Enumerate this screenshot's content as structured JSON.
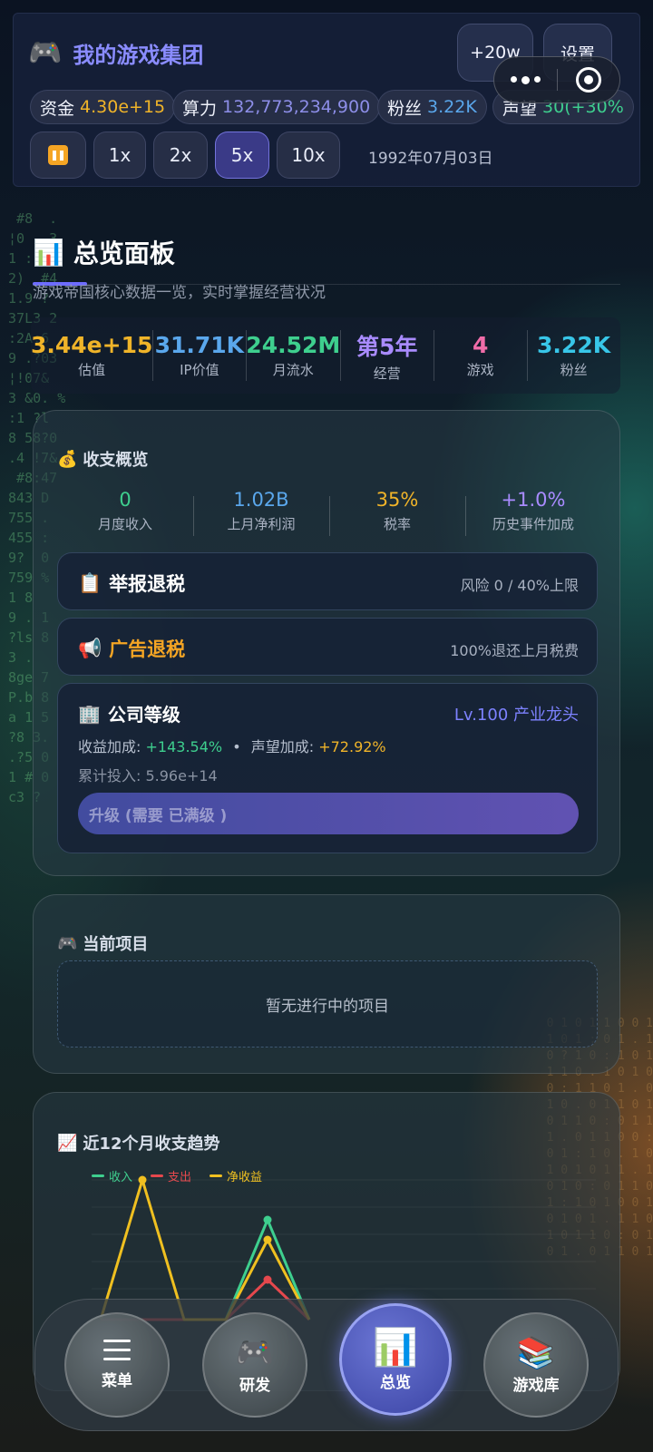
{
  "header": {
    "app_name": "我的游戏集团",
    "logo_icon": "🎮",
    "add_button": "+20w",
    "settings_button": "设置",
    "stats": [
      {
        "label": "资金",
        "value": "4.30e+15",
        "color": "#f0b429"
      },
      {
        "label": "算力",
        "value": "132,773,234,900",
        "color": "#8d8ee8"
      },
      {
        "label": "粉丝",
        "value": "3.22K",
        "color": "#5aa7ec"
      },
      {
        "label": "声望",
        "value": "30(+30%",
        "color": "#3ecf8e"
      }
    ],
    "speeds": [
      "1x",
      "2x",
      "5x",
      "10x"
    ],
    "active_speed": "5x",
    "date": "1992年07月03日"
  },
  "overview": {
    "icon": "📊",
    "title": "总览面板",
    "subtitle": "游戏帝国核心数据一览，实时掌握经营状况",
    "kpis": [
      {
        "value": "3.44e+15",
        "label": "估值",
        "color": "#f0b429"
      },
      {
        "value": "31.71K",
        "label": "IP价值",
        "color": "#5aa7ec"
      },
      {
        "value": "24.52M",
        "label": "月流水",
        "color": "#3ecf8e"
      },
      {
        "value": "第5年",
        "label": "经营",
        "color": "#a98bff"
      },
      {
        "value": "4",
        "label": "游戏",
        "color": "#f06ca8"
      },
      {
        "value": "3.22K",
        "label": "粉丝",
        "color": "#38c6e8"
      }
    ]
  },
  "finance": {
    "icon": "💰",
    "title": "收支概览",
    "items": [
      {
        "value": "0",
        "label": "月度收入",
        "color": "#3ecf8e"
      },
      {
        "value": "1.02B",
        "label": "上月净利润",
        "color": "#5aa7ec"
      },
      {
        "value": "35%",
        "label": "税率",
        "color": "#f0b429"
      },
      {
        "value": "+1.0%",
        "label": "历史事件加成",
        "color": "#a98bff"
      }
    ],
    "report": {
      "icon": "📋",
      "title": "举报退税",
      "info": "风险 0 / 40%上限"
    },
    "ad": {
      "icon": "📢",
      "title": "广告退税",
      "info": "100%退还上月税费"
    },
    "level": {
      "icon": "🏢",
      "title": "公司等级",
      "badge": "Lv.100 产业龙头",
      "income_label": "收益加成:",
      "income_value": "+143.54%",
      "dot": "•",
      "fame_label": "声望加成:",
      "fame_value": "+72.92%",
      "invest": "累计投入: 5.96e+14",
      "upgrade": "升级 (需要 已满级 )"
    }
  },
  "project": {
    "icon": "🎮",
    "title": "当前项目",
    "empty": "暂无进行中的项目"
  },
  "trend": {
    "icon": "📈",
    "title": "近12个月收支趋势",
    "legend": [
      {
        "name": "收入",
        "color": "#3ecf8e"
      },
      {
        "name": "支出",
        "color": "#e5484d"
      },
      {
        "name": "净收益",
        "color": "#f0c020"
      }
    ]
  },
  "chart_data": {
    "type": "line",
    "series": [
      {
        "name": "收入",
        "values": [
          0,
          0,
          0,
          0,
          1.0,
          0
        ]
      },
      {
        "name": "支出",
        "values": [
          0,
          0,
          0,
          0,
          0.4,
          0
        ]
      },
      {
        "name": "净收益",
        "values": [
          0,
          1.4,
          0,
          0,
          0.8,
          0
        ]
      }
    ]
  },
  "nav": [
    {
      "label": "菜单",
      "icon": "menu-icon"
    },
    {
      "label": "研发",
      "icon": "🎮"
    },
    {
      "label": "总览",
      "icon": "📊",
      "active": true
    },
    {
      "label": "游戏库",
      "icon": "📚"
    }
  ]
}
